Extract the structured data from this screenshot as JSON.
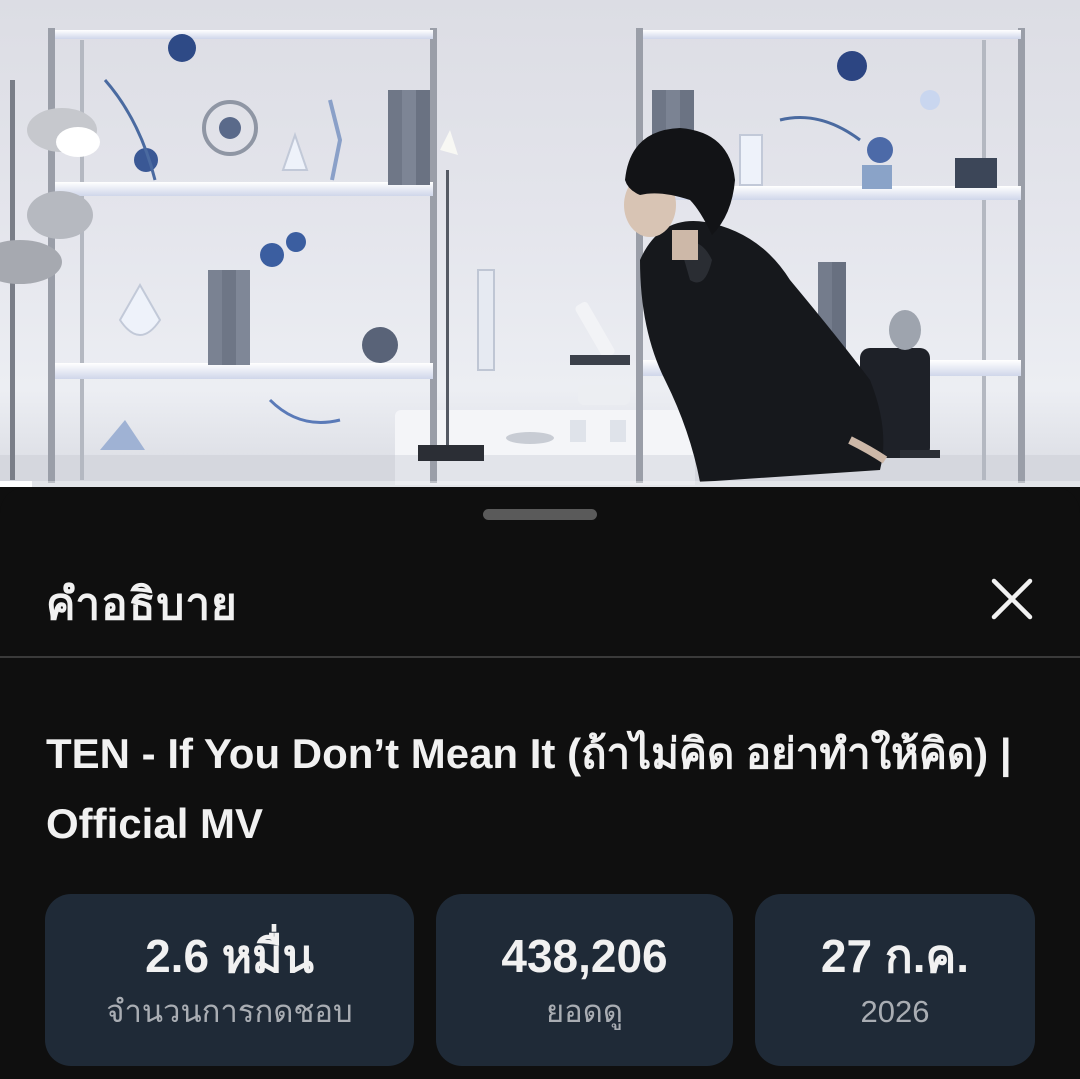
{
  "description_panel": {
    "header_title": "คำอธิบาย",
    "close_icon": "close-icon",
    "video_title": "TEN - If You Don’t Mean It (ถ้าไม่คิด อย่าทำให้คิด) | Official MV",
    "stats": [
      {
        "value": "2.6 หมื่น",
        "label": "จำนวนการกดชอบ"
      },
      {
        "value": "438,206",
        "label": "ยอดดู"
      },
      {
        "value": "27 ก.ค.",
        "label": "2026"
      }
    ]
  },
  "player": {
    "progress_fraction": 0.03
  },
  "colors": {
    "background": "#0f0f0f",
    "stat_card": "#1f2a37",
    "text_primary": "#f1f1f1",
    "text_secondary": "#a9adb3"
  }
}
